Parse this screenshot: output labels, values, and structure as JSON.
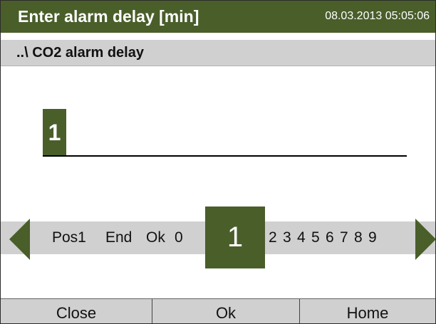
{
  "header": {
    "title": "Enter alarm delay [min]",
    "datetime": "08.03.2013  05:05:06"
  },
  "subheader": {
    "path": "..\\ CO2 alarm delay"
  },
  "entry": {
    "value": "1"
  },
  "picker": {
    "left_arrow_icon": "arrow-left-icon",
    "right_arrow_icon": "arrow-right-icon",
    "pos1": "Pos1",
    "end": "End",
    "ok": "Ok",
    "zero": "0",
    "selected": "1",
    "digits": [
      "2",
      "3",
      "4",
      "5",
      "6",
      "7",
      "8",
      "9"
    ]
  },
  "buttons": {
    "close": "Close",
    "ok": "Ok",
    "home": "Home"
  },
  "colors": {
    "accent": "#4a5e2a",
    "bar_gray": "#d0d0d0"
  }
}
